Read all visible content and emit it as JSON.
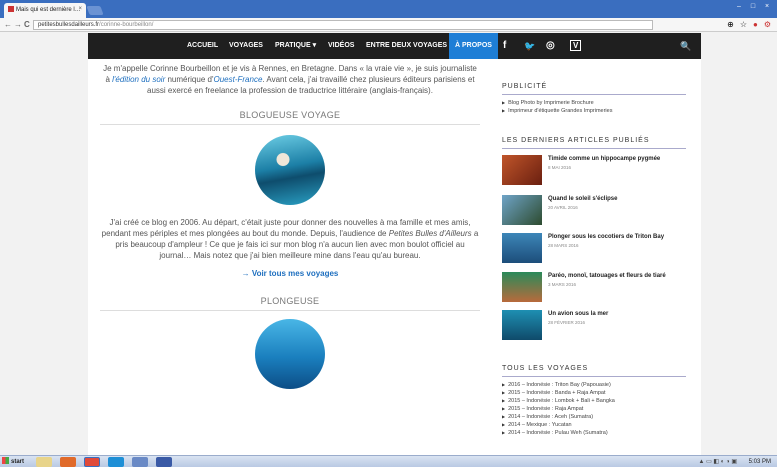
{
  "browser": {
    "tab_title": "Mais qui est dernière l…",
    "tab_close": "×",
    "url_host": "petitesbullesdailleurs.fr",
    "url_path": "/corinne-bourbeillon/",
    "back": "←",
    "forward": "→",
    "reload": "C",
    "window_min": "–",
    "window_max": "□",
    "window_close": "×"
  },
  "nav": {
    "items": [
      "ACCUEIL",
      "VOYAGES",
      "PRATIQUE ▾",
      "VIDÉOS",
      "ENTRE DEUX VOYAGES",
      "À PROPOS"
    ],
    "social": [
      "f",
      "🐦",
      "◎",
      "V"
    ],
    "search": "🔍"
  },
  "main": {
    "intro_1": "Je m'appelle Corinne Bourbeillon et je vis à Rennes, en Bretagne. Dans « la vraie vie », je suis journaliste à ",
    "intro_link1": "l'édition du soir",
    "intro_2": " numérique d'",
    "intro_link2": "Ouest-France",
    "intro_3": ". Avant cela, j'ai travaillé chez plusieurs éditeurs parisiens et aussi exercé en freelance la profession de traductrice littéraire (anglais-français).",
    "section1_title": "BLOGUEUSE VOYAGE",
    "blog_para_1": "J'ai créé ce blog en 2006. Au départ, c'était juste pour donner des nouvelles à ma famille et mes amis, pendant mes périples et mes plongées au bout du monde. Depuis, l'audience de ",
    "blog_para_em": "Petites Bulles d'Ailleurs",
    "blog_para_2": " a pris beaucoup d'ampleur ! Ce que je fais ici sur mon blog n'a aucun lien avec mon boulot officiel au journal… Mais notez que j'ai bien meilleure mine dans l'eau qu'au bureau.",
    "more_link": "→ Voir tous mes voyages",
    "section2_title": "PLONGEUSE"
  },
  "sidebar": {
    "ads_title": "PUBLICITÉ",
    "ads": [
      "Blog Photo by Imprimerie Brochure",
      "Imprimeur d'étiquette Grandes Imprimeries"
    ],
    "latest_title": "LES DERNIERS ARTICLES PUBLIÉS",
    "articles": [
      {
        "title": "Timide comme un hippocampe pygmée",
        "date": "8 MAI 2016"
      },
      {
        "title": "Quand le soleil s'éclipse",
        "date": "20 AVRIL 2016"
      },
      {
        "title": "Plonger sous les cocotiers de Triton Bay",
        "date": "28 MARS 2016"
      },
      {
        "title": "Paréo, monoï, tatouages et fleurs de tiaré",
        "date": "3 MARS 2016"
      },
      {
        "title": "Un avion sous la mer",
        "date": "28 FÉVRIER 2016"
      }
    ],
    "trips_title": "TOUS LES VOYAGES",
    "trips": [
      "2016 – Indonésie : Triton Bay (Papouasie)",
      "2015 – Indonésie : Banda + Raja Ampat",
      "2015 – Indonésie : Lombok + Bali + Bangka",
      "2015 – Indonésie : Raja Ampat",
      "2014 – Indonésie : Aceh (Sumatra)",
      "2014 – Mexique : Yucatan",
      "2014 – Indonésie : Pulau Weh (Sumatra)"
    ]
  },
  "taskbar": {
    "start": "start",
    "clock": "5:03 PM"
  }
}
